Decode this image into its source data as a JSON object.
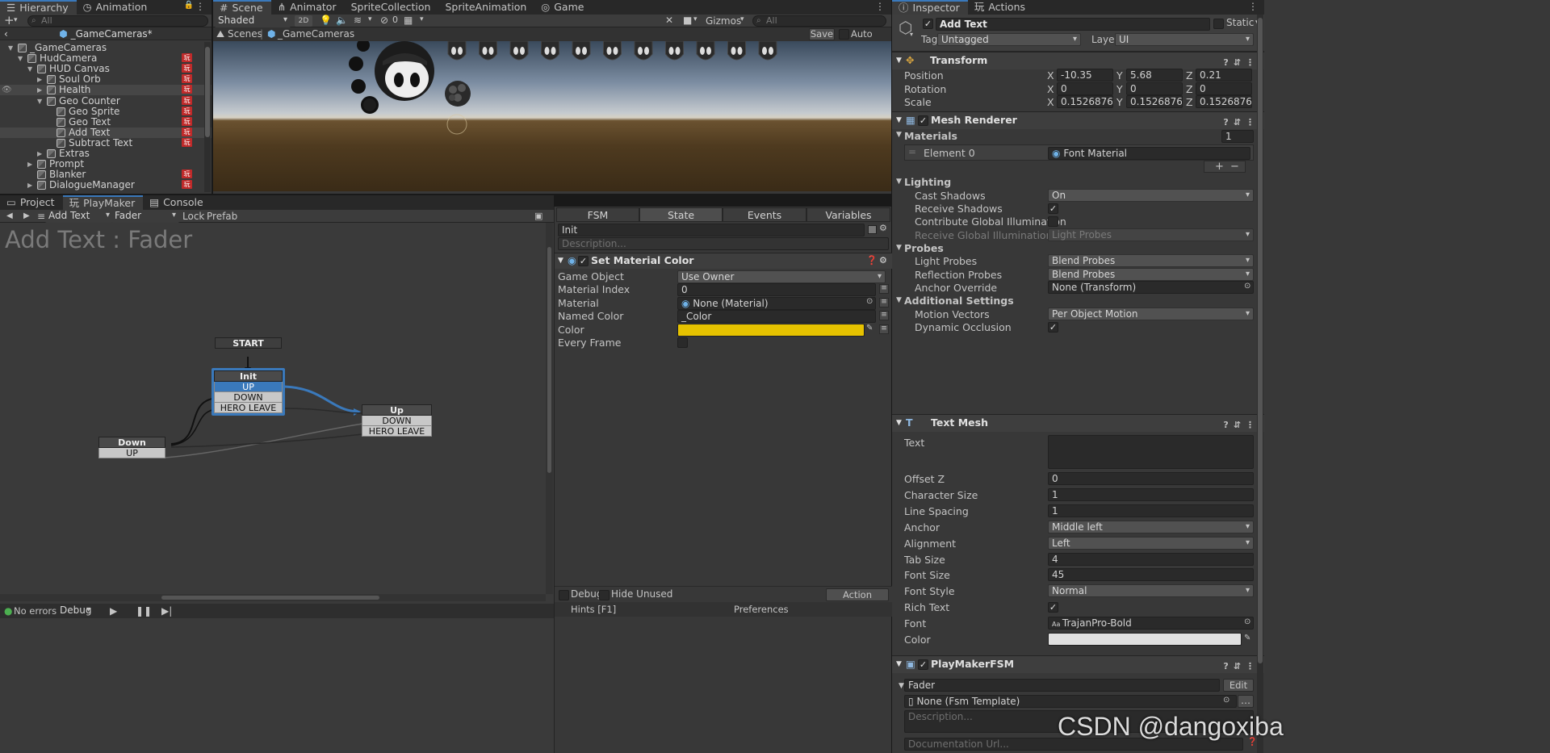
{
  "hierarchy": {
    "tabs": [
      "Hierarchy",
      "Animation"
    ],
    "search_placeholder": "All",
    "scene_title": "_GameCameras*",
    "items": [
      {
        "label": "_GameCameras",
        "depth": 1,
        "expanded": true,
        "badge": false
      },
      {
        "label": "HudCamera",
        "depth": 2,
        "expanded": true,
        "badge": true
      },
      {
        "label": "HUD Canvas",
        "depth": 3,
        "expanded": true,
        "badge": true
      },
      {
        "label": "Soul Orb",
        "depth": 4,
        "expanded": false,
        "badge": true
      },
      {
        "label": "Health",
        "depth": 4,
        "expanded": false,
        "badge": true
      },
      {
        "label": "Geo Counter",
        "depth": 4,
        "expanded": true,
        "badge": true
      },
      {
        "label": "Geo Sprite",
        "depth": 5,
        "expanded": null,
        "badge": true
      },
      {
        "label": "Geo Text",
        "depth": 5,
        "expanded": null,
        "badge": true
      },
      {
        "label": "Add Text",
        "depth": 5,
        "expanded": null,
        "badge": true
      },
      {
        "label": "Subtract Text",
        "depth": 5,
        "expanded": null,
        "badge": true
      },
      {
        "label": "Extras",
        "depth": 4,
        "expanded": false,
        "badge": false
      },
      {
        "label": "Prompt",
        "depth": 3,
        "expanded": false,
        "badge": false
      },
      {
        "label": "Blanker",
        "depth": 3,
        "expanded": null,
        "badge": true
      },
      {
        "label": "DialogueManager",
        "depth": 3,
        "expanded": false,
        "badge": true
      }
    ]
  },
  "scene": {
    "tabs": [
      "Scene",
      "Animator",
      "SpriteCollection",
      "SpriteAnimation",
      "Game"
    ],
    "shading_mode": "Shaded",
    "toggle_2d": "2D",
    "hidden_count": "0",
    "gizmos_label": "Gizmos",
    "search_placeholder": "All",
    "breadcrumb_root": "Scenes",
    "breadcrumb_current": "_GameCameras",
    "save_label": "Save",
    "auto_save_label": "Auto Save"
  },
  "bottom": {
    "tabs": [
      "Project",
      "PlayMaker",
      "Console"
    ],
    "go_select": "Add Text",
    "fsm_select": "Fader",
    "lock_label": "Lock",
    "prefab_label": "Prefab",
    "graph_title": "Add Text : Fader",
    "nodes": {
      "start": "START",
      "init": {
        "title": "Init",
        "events": [
          "UP",
          "DOWN",
          "HERO LEAVE"
        ]
      },
      "up": {
        "title": "Up",
        "events": [
          "DOWN",
          "HERO LEAVE"
        ]
      },
      "down": {
        "title": "Down",
        "events": [
          "UP"
        ]
      }
    },
    "status_errors": "No errors",
    "debug_label": "Debug"
  },
  "fsm_editor": {
    "tabs": [
      "FSM",
      "State",
      "Events",
      "Variables"
    ],
    "state_name": "Init",
    "description_placeholder": "Description...",
    "action_title": "Set Material Color",
    "fields": [
      {
        "label": "Game Object",
        "value": "Use Owner",
        "kind": "dropdown"
      },
      {
        "label": "Material Index",
        "value": "0",
        "kind": "text"
      },
      {
        "label": "Material",
        "value": "None (Material)",
        "kind": "object"
      },
      {
        "label": "Named Color",
        "value": "_Color",
        "kind": "text"
      },
      {
        "label": "Color",
        "value": "",
        "kind": "color"
      },
      {
        "label": "Every Frame",
        "value": "",
        "kind": "checkbox"
      }
    ],
    "color_value": "#e6c200",
    "debug_label": "Debug",
    "hide_unused_label": "Hide Unused",
    "action_browser_label": "Action Browser",
    "hints_label": "Hints [F1]",
    "preferences_label": "Preferences"
  },
  "inspector": {
    "tabs": [
      "Inspector",
      "Actions"
    ],
    "object_name": "Add Text",
    "static_label": "Static",
    "tag_label": "Tag",
    "tag_value": "Untagged",
    "layer_label": "Layer",
    "layer_value": "UI",
    "transform": {
      "title": "Transform",
      "rows": [
        {
          "label": "Position",
          "x": "-10.35",
          "y": "5.68",
          "z": "0.21"
        },
        {
          "label": "Rotation",
          "x": "0",
          "y": "0",
          "z": "0"
        },
        {
          "label": "Scale",
          "x": "0.1526876",
          "y": "0.1526876",
          "z": "0.1526876"
        }
      ]
    },
    "mesh_renderer": {
      "title": "Mesh Renderer",
      "materials_label": "Materials",
      "materials_count": "1",
      "element0_label": "Element 0",
      "element0_value": "Font Material",
      "lighting_label": "Lighting",
      "cast_shadows_label": "Cast Shadows",
      "cast_shadows_value": "On",
      "receive_shadows_label": "Receive Shadows",
      "contribute_gi_label": "Contribute Global Illumination",
      "receive_gi_label": "Receive Global Illumination",
      "receive_gi_value": "Light Probes",
      "probes_label": "Probes",
      "light_probes_label": "Light Probes",
      "light_probes_value": "Blend Probes",
      "reflection_probes_label": "Reflection Probes",
      "reflection_probes_value": "Blend Probes",
      "anchor_override_label": "Anchor Override",
      "anchor_override_value": "None (Transform)",
      "additional_label": "Additional Settings",
      "motion_vectors_label": "Motion Vectors",
      "motion_vectors_value": "Per Object Motion",
      "dynamic_occlusion_label": "Dynamic Occlusion"
    },
    "text_mesh": {
      "title": "Text Mesh",
      "text_label": "Text",
      "rows": [
        {
          "label": "Offset Z",
          "value": "0",
          "kind": "text"
        },
        {
          "label": "Character Size",
          "value": "1",
          "kind": "text"
        },
        {
          "label": "Line Spacing",
          "value": "1",
          "kind": "text"
        },
        {
          "label": "Anchor",
          "value": "Middle left",
          "kind": "dropdown"
        },
        {
          "label": "Alignment",
          "value": "Left",
          "kind": "dropdown"
        },
        {
          "label": "Tab Size",
          "value": "4",
          "kind": "text"
        },
        {
          "label": "Font Size",
          "value": "45",
          "kind": "text"
        },
        {
          "label": "Font Style",
          "value": "Normal",
          "kind": "dropdown"
        },
        {
          "label": "Rich Text",
          "value": "",
          "kind": "checkbox"
        },
        {
          "label": "Font",
          "value": "TrajanPro-Bold",
          "kind": "object"
        },
        {
          "label": "Color",
          "value": "",
          "kind": "color"
        }
      ]
    },
    "playmaker_fsm": {
      "title": "PlayMakerFSM",
      "fsm_name": "Fader",
      "edit_label": "Edit",
      "template_value": "None (Fsm Template)",
      "description_placeholder": "Description...",
      "doc_url_placeholder": "Documentation Url..."
    }
  },
  "watermark": "CSDN @dangoxiba",
  "colors": {
    "accent": "#3a79bb",
    "badge": "#c02a2a",
    "selected_row": "#2c5d87"
  }
}
